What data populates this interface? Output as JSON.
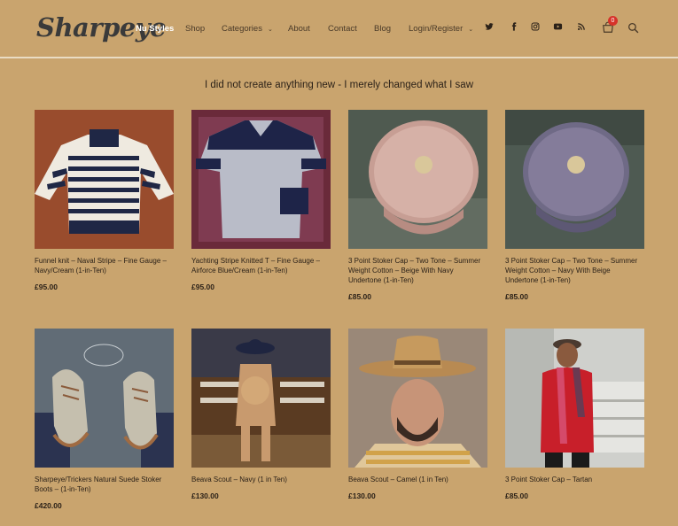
{
  "brand": {
    "logo_text": "Sharpeye"
  },
  "nav": {
    "items": [
      {
        "label": "Nu Styles",
        "active": true
      },
      {
        "label": "Shop"
      },
      {
        "label": "Categories",
        "has_dropdown": true
      },
      {
        "label": "About"
      },
      {
        "label": "Contact"
      },
      {
        "label": "Blog"
      },
      {
        "label": "Login/Register",
        "has_dropdown": true
      }
    ],
    "social_icons": [
      "twitter-icon",
      "facebook-icon",
      "instagram-icon",
      "youtube-icon",
      "rss-icon"
    ],
    "cart_count": "0"
  },
  "tagline": "I did not create anything new - I merely changed what I saw",
  "products": [
    {
      "title": "Funnel knit – Naval Stripe – Fine Gauge – Navy/Cream (1-in-Ten)",
      "price": "£95.00"
    },
    {
      "title": "Yachting Stripe Knitted T – Fine Gauge – Airforce Blue/Cream (1-in-Ten)",
      "price": "£95.00"
    },
    {
      "title": "3 Point Stoker Cap – Two Tone – Summer Weight Cotton – Beige With Navy Undertone (1-in-Ten)",
      "price": "£85.00"
    },
    {
      "title": "3 Point Stoker Cap – Two Tone – Summer Weight Cotton – Navy With Beige Undertone (1-in-Ten)",
      "price": "£85.00"
    },
    {
      "title": "Sharpeye/Trickers Natural Suede Stoker Boots – (1-in-Ten)",
      "price": "£420.00"
    },
    {
      "title": "Beava Scout – Navy (1 in Ten)",
      "price": "£130.00"
    },
    {
      "title": "Beava Scout – Camel (1 in Ten)",
      "price": "£130.00"
    },
    {
      "title": "3 Point Stoker Cap – Tartan",
      "price": "£85.00"
    }
  ],
  "colors": {
    "background": "#c9a46e",
    "active_nav": "#ffffff",
    "badge": "#d6332a"
  }
}
